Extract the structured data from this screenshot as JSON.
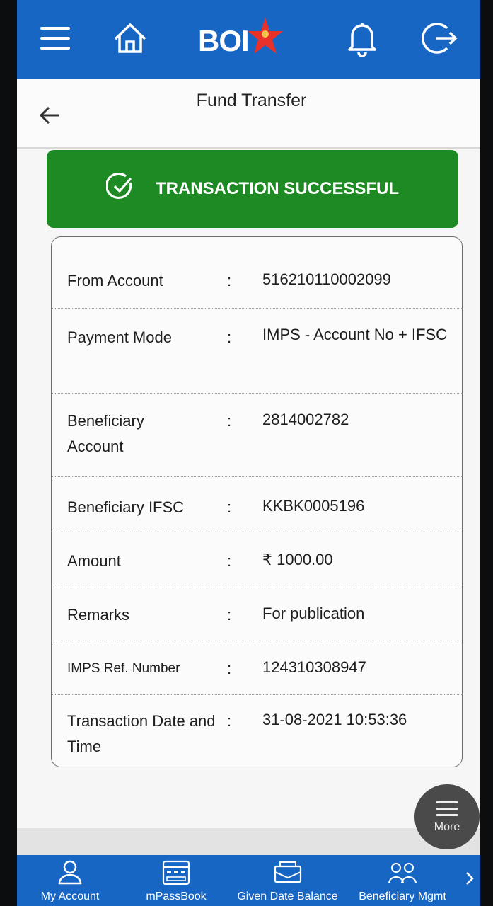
{
  "header": {
    "brand": "BOI",
    "brand_color": "#1766c4",
    "icons": [
      "menu-icon",
      "home-icon",
      "bell-icon",
      "logout-icon"
    ]
  },
  "page": {
    "title": "Fund Transfer"
  },
  "status": {
    "label": "TRANSACTION SUCCESSFUL",
    "color": "#1d8a23"
  },
  "details": [
    {
      "label": "From Account",
      "value": "516210110002099"
    },
    {
      "label": "Payment Mode",
      "value": "IMPS - Account No + IFSC"
    },
    {
      "label": "Beneficiary Account",
      "value": "2814002782"
    },
    {
      "label": "Beneficiary IFSC",
      "value": "KKBK0005196"
    },
    {
      "label": "Amount",
      "value": "₹ 1000.00"
    },
    {
      "label": "Remarks",
      "value": "For publication"
    },
    {
      "label": "IMPS Ref. Number",
      "value": "124310308947"
    },
    {
      "label": "Transaction Date and Time",
      "value": "31-08-2021 10:53:36"
    }
  ],
  "separator": ":",
  "fab": {
    "label": "More"
  },
  "bottom_nav": [
    {
      "label": "My Account",
      "icon": "user-icon"
    },
    {
      "label": "mPassBook",
      "icon": "passbook-icon"
    },
    {
      "label": "Given Date Balance",
      "icon": "balance-icon"
    },
    {
      "label": "Beneficiary Mgmt",
      "icon": "beneficiary-icon"
    }
  ]
}
